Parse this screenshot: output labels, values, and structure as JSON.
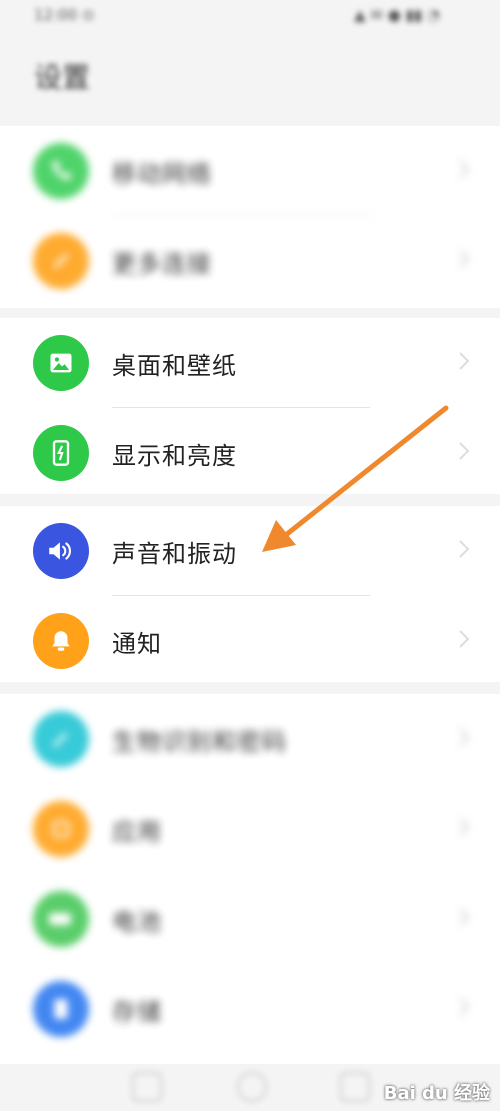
{
  "status_bar": {
    "left": "12:00 ⊙",
    "right": "▲ ✉ ● ▮▮ ◔"
  },
  "page_title": "设置",
  "groups": [
    {
      "items": [
        {
          "label": "移动网络",
          "color": "#3ecf5b",
          "icon": "phone-icon",
          "blurred": true
        },
        {
          "label": "更多连接",
          "color": "#ffa21a",
          "icon": "link-icon",
          "blurred": true
        }
      ]
    },
    {
      "items": [
        {
          "label": "桌面和壁纸",
          "color": "#2fc94a",
          "icon": "image-icon",
          "blurred": false
        },
        {
          "label": "显示和亮度",
          "color": "#2fc94a",
          "icon": "display-icon",
          "blurred": false
        }
      ]
    },
    {
      "items": [
        {
          "label": "声音和振动",
          "color": "#3a55e0",
          "icon": "speaker-icon",
          "blurred": false
        },
        {
          "label": "通知",
          "color": "#ffa21a",
          "icon": "bell-icon",
          "blurred": false
        }
      ]
    },
    {
      "items": [
        {
          "label": "生物识别和密码",
          "color": "#22c5d4",
          "icon": "key-icon",
          "blurred": true
        },
        {
          "label": "应用",
          "color": "#ffa21a",
          "icon": "apps-icon",
          "blurred": true
        },
        {
          "label": "电池",
          "color": "#48c95a",
          "icon": "battery-icon",
          "blurred": true
        },
        {
          "label": "存储",
          "color": "#2e7af0",
          "icon": "storage-icon",
          "blurred": true
        }
      ]
    }
  ],
  "watermark": "Bai du 经验",
  "arrow_color": "#f0892e"
}
